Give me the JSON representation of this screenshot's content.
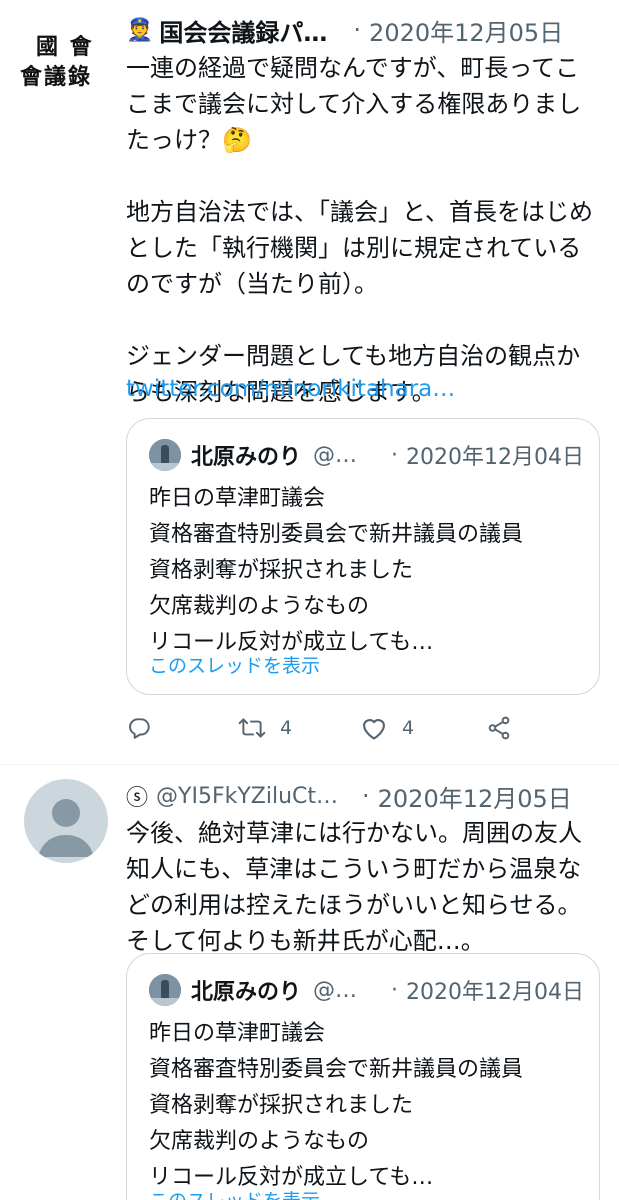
{
  "tweets": [
    {
      "avatar_text_1": "國 會",
      "avatar_text_2": "會議錄",
      "badge_emoji": "👮",
      "name": "国会会議録パ…",
      "dot": "·",
      "date": "2020年12月05日",
      "body": "一連の経過で疑問なんですが、町長ってここまで議会に対して介入する権限ありましたっけ？🤔\n\n地方自治法では、「議会」と、首長をはじめとした「執行機関」は別に規定されているのですが（当たり前）。\n\nジェンダー問題としても地方自治の観点からも深刻な問題を感じます。",
      "link": "twitter.com/minorikitahara…",
      "quote": {
        "name": "北原みのり",
        "handle": "@…",
        "dot": "·",
        "date": "2020年12月04日",
        "body": "昨日の草津町議会\n資格審査特別委員会で新井議員の議員\n資格剥奪が採択されました\n欠席裁判のようなもの\nリコール反対が成立しても…",
        "thread_link": "このスレッドを表示"
      },
      "actions": {
        "retweets": "4",
        "likes": "4"
      }
    },
    {
      "badge": "ⓢ",
      "name": "@YI5FkYZiluCt…",
      "dot": "·",
      "date": "2020年12月05日",
      "body": "今後、絶対草津には行かない。周囲の友人知人にも、草津はこういう町だから温泉などの利用は控えたほうがいいと知らせる。そして何よりも新井氏が心配…。",
      "quote": {
        "name": "北原みのり",
        "handle": "@…",
        "dot": "·",
        "date": "2020年12月04日",
        "body": "昨日の草津町議会\n資格審査特別委員会で新井議員の議員\n資格剥奪が採択されました\n欠席裁判のようなもの\nリコール反対が成立しても…",
        "thread_link": "このスレッドを表示"
      }
    }
  ],
  "icons": {
    "reply": "reply-icon",
    "retweet": "retweet-icon",
    "like": "heart-icon",
    "share": "share-icon"
  },
  "colors": {
    "link": "#1d9bf0",
    "muted": "#536471",
    "border": "#cfd9de",
    "text": "#0f1419"
  }
}
